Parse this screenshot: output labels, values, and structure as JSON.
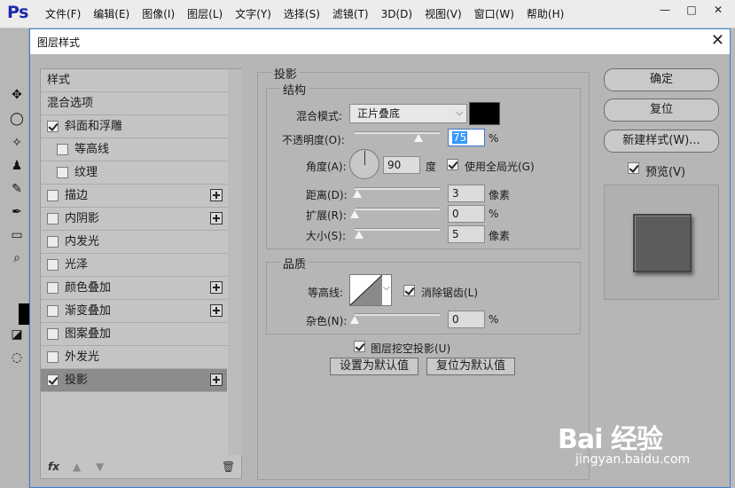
{
  "app": {
    "logo": "Ps",
    "menu": [
      "文件(F)",
      "编辑(E)",
      "图像(I)",
      "图层(L)",
      "文字(Y)",
      "选择(S)",
      "滤镜(T)",
      "3D(D)",
      "视图(V)",
      "窗口(W)",
      "帮助(H)"
    ],
    "window_controls": {
      "minimize": "—",
      "maximize": "□",
      "close": "✕"
    }
  },
  "dialog": {
    "title": "图层样式",
    "close": "✕"
  },
  "style_list": {
    "header": "样式",
    "blend_options": "混合选项",
    "items": [
      {
        "label": "斜面和浮雕",
        "checked": true,
        "plus": false,
        "indent": 0
      },
      {
        "label": "等高线",
        "checked": false,
        "plus": false,
        "indent": 1
      },
      {
        "label": "纹理",
        "checked": false,
        "plus": false,
        "indent": 1
      },
      {
        "label": "描边",
        "checked": false,
        "plus": true,
        "indent": 0
      },
      {
        "label": "内阴影",
        "checked": false,
        "plus": true,
        "indent": 0
      },
      {
        "label": "内发光",
        "checked": false,
        "plus": false,
        "indent": 0
      },
      {
        "label": "光泽",
        "checked": false,
        "plus": false,
        "indent": 0
      },
      {
        "label": "颜色叠加",
        "checked": false,
        "plus": true,
        "indent": 0
      },
      {
        "label": "渐变叠加",
        "checked": false,
        "plus": true,
        "indent": 0
      },
      {
        "label": "图案叠加",
        "checked": false,
        "plus": false,
        "indent": 0
      },
      {
        "label": "外发光",
        "checked": false,
        "plus": false,
        "indent": 0
      },
      {
        "label": "投影",
        "checked": true,
        "plus": true,
        "indent": 0,
        "selected": true
      }
    ],
    "footer": {
      "fx": "fx",
      "up": "▲",
      "down": "▼",
      "trash": "🗑"
    }
  },
  "drop_shadow": {
    "title": "投影",
    "structure": {
      "title": "结构",
      "blend_mode_label": "混合模式:",
      "blend_mode_value": "正片叠底",
      "opacity_label": "不透明度(O):",
      "opacity_value": "75",
      "opacity_level": 0.75,
      "angle_label": "角度(A):",
      "angle_value": "90",
      "angle_unit": "度",
      "global_light_label": "使用全局光(G)",
      "global_light_checked": true,
      "distance_label": "距离(D):",
      "distance_value": "3",
      "distance_level": 0.03,
      "spread_label": "扩展(R):",
      "spread_value": "0",
      "spread_level": 0,
      "size_label": "大小(S):",
      "size_value": "5",
      "size_level": 0.05,
      "pixel_unit": "像素",
      "percent_unit": "%",
      "shadow_color": "#000000"
    },
    "quality": {
      "title": "品质",
      "contour_label": "等高线:",
      "antialias_label": "消除锯齿(L)",
      "antialias_checked": true,
      "noise_label": "杂色(N):",
      "noise_value": "0",
      "noise_level": 0,
      "percent_unit": "%"
    },
    "knockout_label": "图层挖空投影(U)",
    "knockout_checked": true,
    "set_default": "设置为默认值",
    "reset_default": "复位为默认值"
  },
  "actions": {
    "ok": "确定",
    "reset": "复位",
    "new_style": "新建样式(W)...",
    "preview_label": "预览(V)",
    "preview_checked": true
  },
  "watermark": {
    "brand": "Bai 经验",
    "url": "jingyan.baidu.com"
  }
}
